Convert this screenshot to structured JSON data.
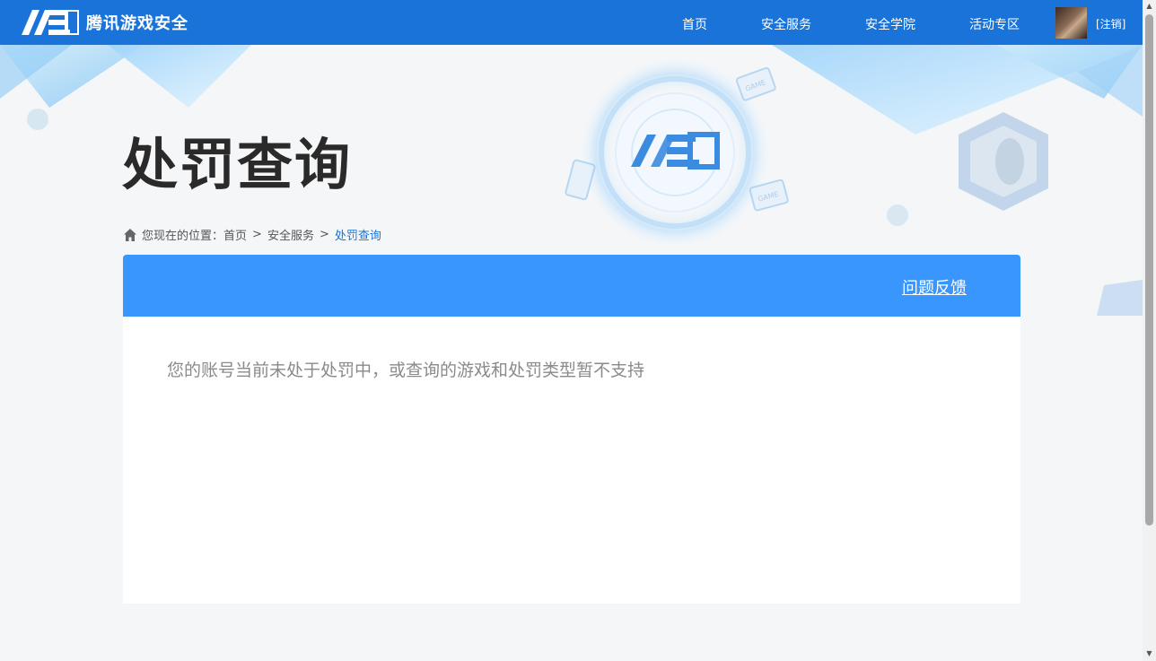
{
  "brand": {
    "logo_text": "腾讯游戏安全"
  },
  "nav": {
    "items": [
      "首页",
      "安全服务",
      "安全学院",
      "活动专区"
    ],
    "logout": "[注销]"
  },
  "page": {
    "title": "处罚查询"
  },
  "breadcrumb": {
    "prefix": "您现在的位置：",
    "items": [
      "首页",
      "安全服务",
      "处罚查询"
    ],
    "sep": ">"
  },
  "panel": {
    "feedback_label": "问题反馈",
    "message": "您的账号当前未处于处罚中，或查询的游戏和处罚类型暂不支持"
  },
  "colors": {
    "nav_bg": "#1a73d8",
    "panel_head": "#3896fd"
  }
}
